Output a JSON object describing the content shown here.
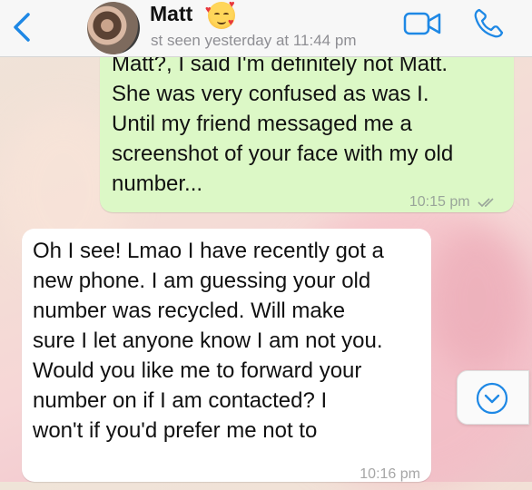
{
  "header": {
    "contact_name": "Matt",
    "status": "st seen yesterday at 11:44 pm",
    "icons": {
      "back": "chevron-left-icon",
      "avatar": "contact-photo",
      "emoji": "smiling-face-with-hearts",
      "video": "video-camera-icon",
      "call": "phone-icon"
    }
  },
  "messages": [
    {
      "direction": "outgoing",
      "text": "Matt?, I said I'm definitely not Matt.\nShe was very confused as was I.\nUntil my friend messaged me a\nscreenshot of your face with my old\nnumber...",
      "time": "10:15 pm",
      "read": true
    },
    {
      "direction": "incoming",
      "text": "Oh I see! Lmao I have recently got a\nnew phone. I am guessing your old\nnumber was recycled. Will make\nsure I let anyone know I am not you.\nWould you like me to forward your\nnumber on if I am contacted? I\nwon't if you'd prefer me not to",
      "time": "10:16 pm"
    }
  ],
  "colors": {
    "accent": "#1e88e5",
    "outgoing_bubble": "#dcf8c6",
    "incoming_bubble": "#ffffff",
    "header_bg": "#f7f7f7"
  }
}
